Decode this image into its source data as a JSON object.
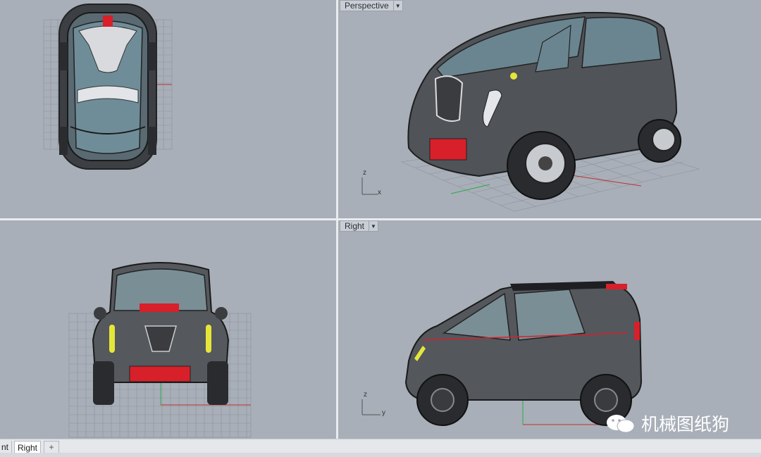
{
  "viewports": {
    "top": {
      "label": ""
    },
    "perspective": {
      "label": "Perspective"
    },
    "front": {
      "label": ""
    },
    "right": {
      "label": "Right"
    }
  },
  "axes": {
    "perspective": {
      "z": "z",
      "x": "x"
    },
    "right": {
      "z": "z",
      "y": "y"
    }
  },
  "tabs": {
    "partial": "nt",
    "active": "Right",
    "add": "+"
  },
  "watermark": {
    "text": "机械图纸狗"
  },
  "colors": {
    "viewport_bg": "#a8afb8",
    "body_dark": "#4a4d52",
    "accent_red": "#d8202a",
    "accent_yellow": "#e6e63a",
    "glass": "#6d8a96"
  }
}
